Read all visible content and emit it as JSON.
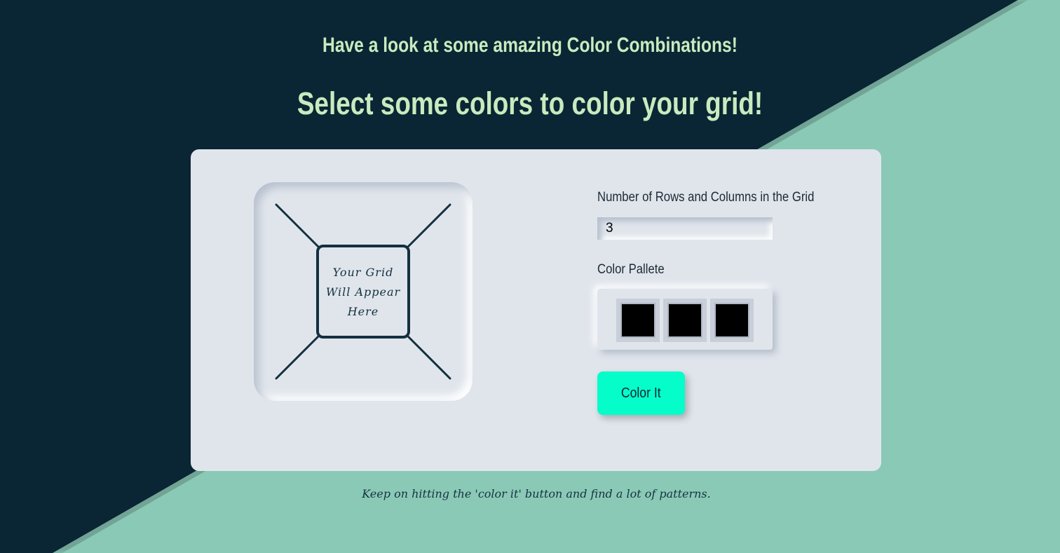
{
  "header": {
    "subtitle": "Have a look at some amazing Color Combinations!",
    "title": "Select some colors to color your grid!"
  },
  "preview": {
    "placeholder_line_1": "Your Grid",
    "placeholder_line_2": "Will Appear",
    "placeholder_line_3": "Here"
  },
  "form": {
    "rows_label": "Number of Rows and Columns in the Grid",
    "rows_value": "3",
    "palette_label": "Color Pallete",
    "palette_colors": [
      "#000000",
      "#000000",
      "#000000"
    ],
    "submit_label": "Color It"
  },
  "footer": {
    "note": "Keep on hitting the 'color it' button and find a lot of patterns."
  },
  "colors": {
    "background_dark": "#0a2533",
    "background_light": "#8ac9b6",
    "heading": "#c8ebbf",
    "card": "#e0e5ec",
    "button": "#05fdca"
  }
}
